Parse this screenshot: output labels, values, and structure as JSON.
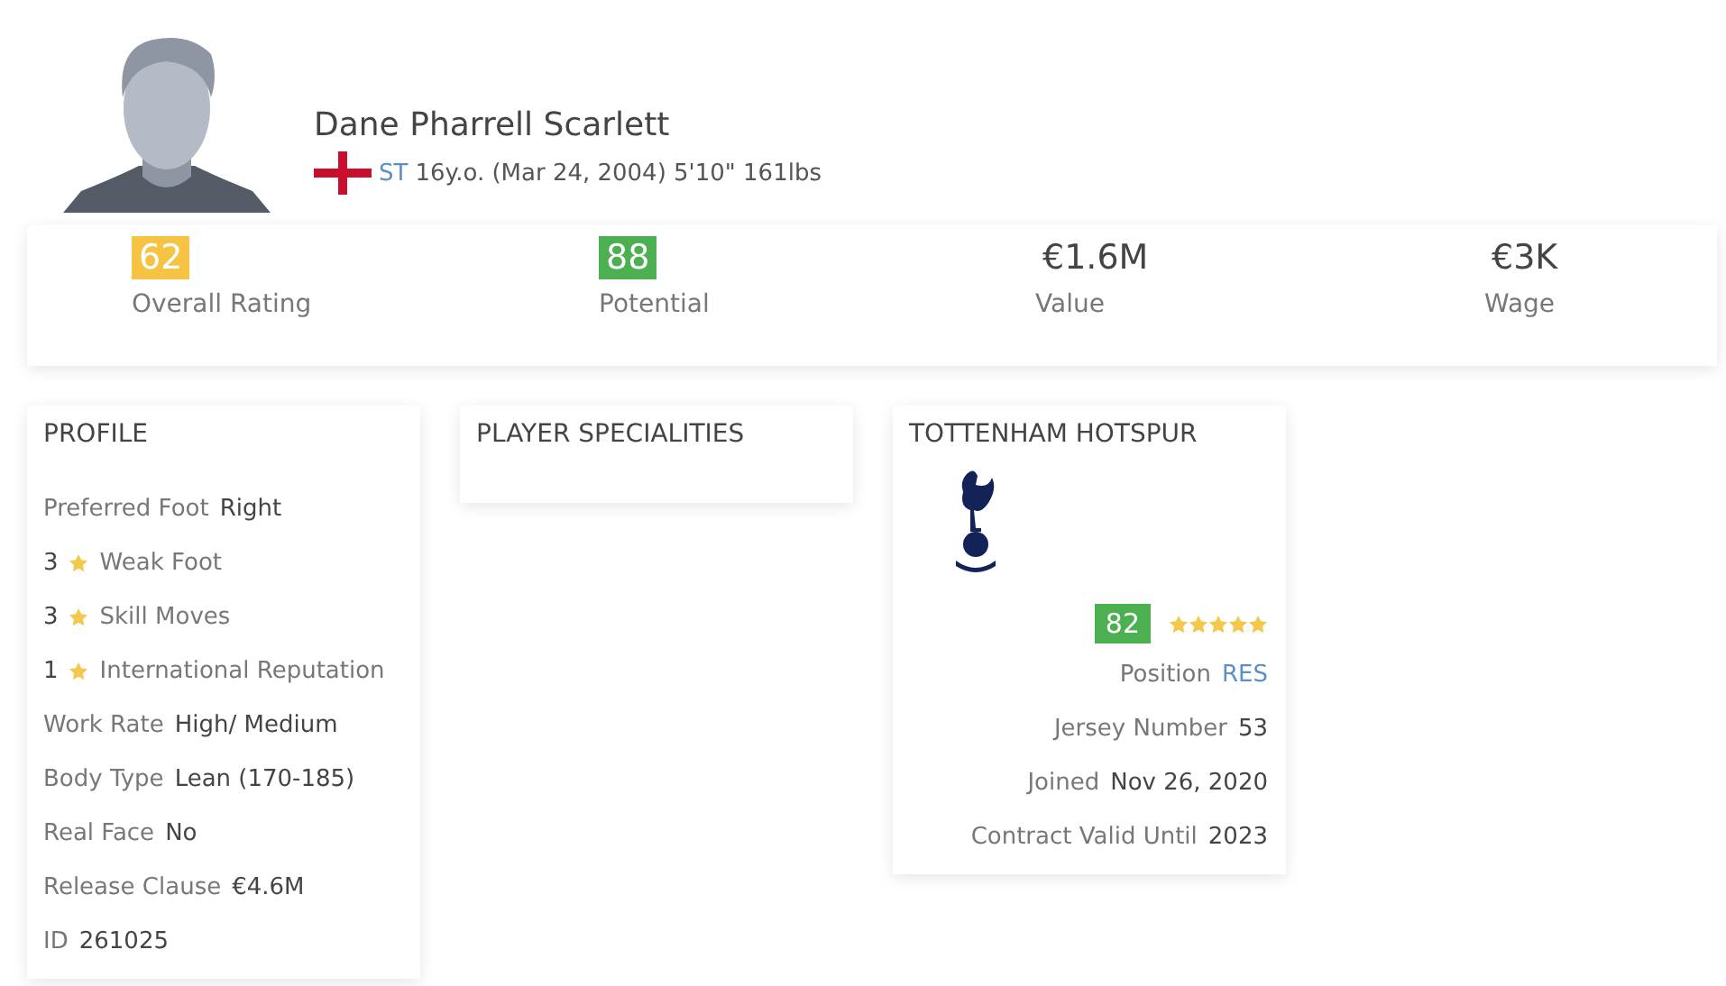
{
  "player": {
    "name": "Dane Pharrell Scarlett",
    "position": "ST",
    "details": "16y.o. (Mar 24, 2004) 5'10\" 161lbs"
  },
  "stats": [
    {
      "value": "62",
      "label": "Overall Rating",
      "color": "#f6c343"
    },
    {
      "value": "88",
      "label": "Potential",
      "color": "#4caf50"
    },
    {
      "value": "€1.6M",
      "label": "Value"
    },
    {
      "value": "€3K",
      "label": "Wage"
    }
  ],
  "profile": {
    "title": "PROFILE",
    "rows": [
      {
        "kind": "pair",
        "label": "Preferred Foot",
        "value": "Right"
      },
      {
        "kind": "star",
        "value": "3",
        "label": "Weak Foot"
      },
      {
        "kind": "star",
        "value": "3",
        "label": "Skill Moves"
      },
      {
        "kind": "star",
        "value": "1",
        "label": "International Reputation"
      },
      {
        "kind": "pair",
        "label": "Work Rate",
        "value": "High/ Medium"
      },
      {
        "kind": "pair",
        "label": "Body Type",
        "value": "Lean (170-185)"
      },
      {
        "kind": "pair",
        "label": "Real Face",
        "value": "No"
      },
      {
        "kind": "pair",
        "label": "Release Clause",
        "value": "€4.6M"
      },
      {
        "kind": "pair",
        "label": "ID",
        "value": "261025"
      }
    ]
  },
  "specialities": {
    "title": "PLAYER SPECIALITIES"
  },
  "club": {
    "title": "TOTTENHAM HOTSPUR",
    "rating": {
      "value": "82",
      "color": "#4caf50"
    },
    "stars": 5,
    "rows": [
      {
        "label": "Position",
        "value": "RES",
        "kind": "link"
      },
      {
        "label": "Jersey Number",
        "value": "53",
        "kind": "plain"
      },
      {
        "label": "Joined",
        "value": "Nov 26, 2020",
        "kind": "plain"
      },
      {
        "label": "Contract Valid Until",
        "value": "2023",
        "kind": "plain"
      }
    ]
  }
}
